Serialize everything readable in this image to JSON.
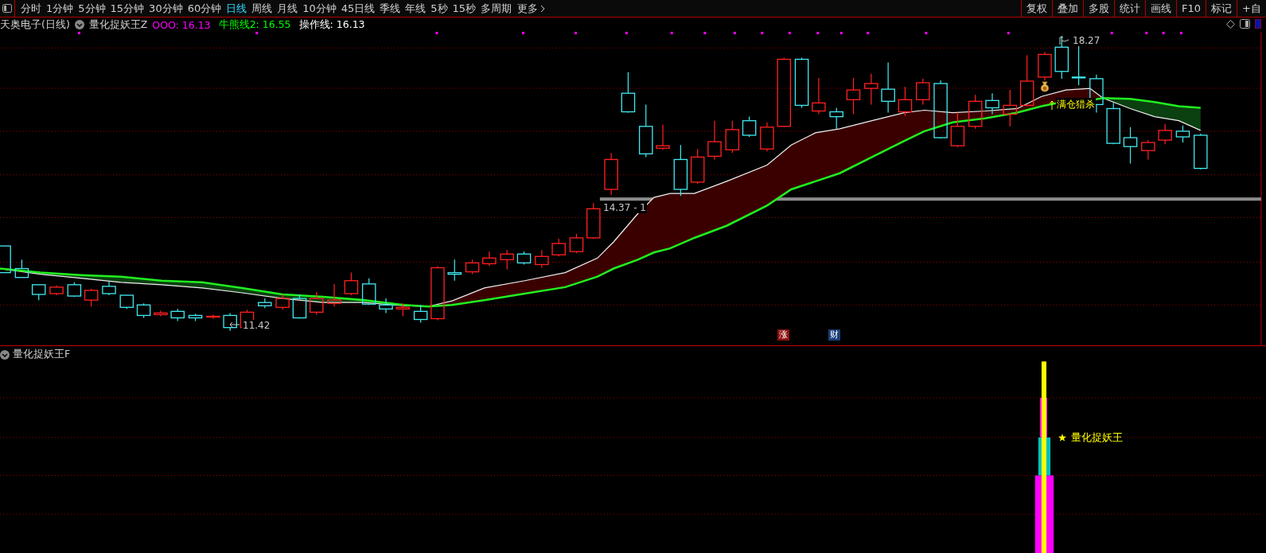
{
  "toolbar": {
    "periods": [
      {
        "label": "分时",
        "selected": false
      },
      {
        "label": "1分钟",
        "selected": false
      },
      {
        "label": "5分钟",
        "selected": false
      },
      {
        "label": "15分钟",
        "selected": false
      },
      {
        "label": "30分钟",
        "selected": false
      },
      {
        "label": "60分钟",
        "selected": false
      },
      {
        "label": "日线",
        "selected": true
      },
      {
        "label": "周线",
        "selected": false
      },
      {
        "label": "月线",
        "selected": false
      },
      {
        "label": "10分钟",
        "selected": false
      },
      {
        "label": "45日线",
        "selected": false
      },
      {
        "label": "季线",
        "selected": false
      },
      {
        "label": "年线",
        "selected": false
      },
      {
        "label": "5秒",
        "selected": false
      },
      {
        "label": "15秒",
        "selected": false
      },
      {
        "label": "多周期",
        "selected": false
      }
    ],
    "more": "更多",
    "tools": [
      "复权",
      "叠加",
      "多股",
      "统计",
      "画线",
      "F10",
      "标记",
      "+自"
    ]
  },
  "header": {
    "stock": "天奥电子(日线)",
    "indicator": "量化捉妖王Z",
    "values": [
      {
        "text": "OOO: 16.13",
        "color": "#ff00ff"
      },
      {
        "text": "牛熊线2: 16.55",
        "color": "#00ff00"
      },
      {
        "text": "操作线: 16.13",
        "color": "#ffffff"
      }
    ]
  },
  "chart_labels": [
    {
      "kind": "high",
      "text": "18.27"
    },
    {
      "kind": "level",
      "text": "14.37 - 1"
    },
    {
      "kind": "low",
      "text": "11.42"
    },
    {
      "kind": "signal",
      "text": "满仓猎杀"
    }
  ],
  "badges": [
    {
      "text": "涨",
      "color": "#8b1010"
    },
    {
      "text": "财",
      "color": "#1c3f78"
    }
  ],
  "lower_panel": {
    "title": "量化捉妖王F",
    "signal": "量化捉妖王"
  }
}
